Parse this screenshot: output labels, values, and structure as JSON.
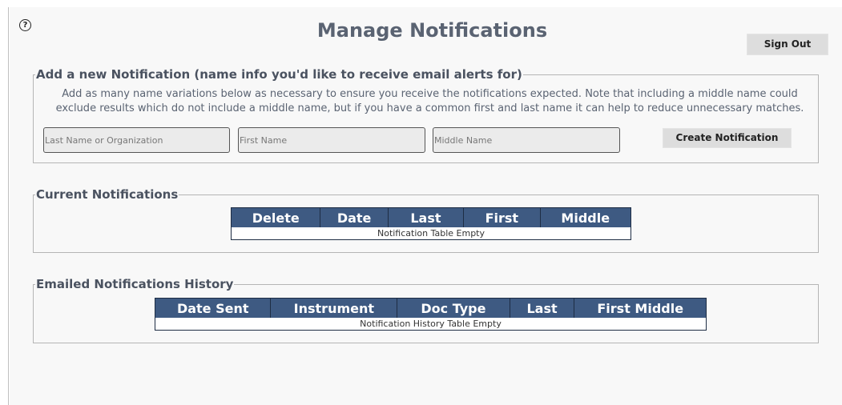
{
  "header": {
    "title": "Manage Notifications",
    "help_icon": "?",
    "sign_out_label": "Sign Out"
  },
  "add_section": {
    "legend": "Add a new Notification (name info you'd like to receive email alerts for)",
    "instructions_line1": "Add as many name variations below as necessary to ensure you receive the notifications expected. Note that including a middle name could",
    "instructions_line2": "exclude results which do not include a middle name, but if you have a common first and last name it can help to reduce unnecessary matches.",
    "last_placeholder": "Last Name or Organization",
    "first_placeholder": "First Name",
    "middle_placeholder": "Middle Name",
    "create_label": "Create Notification"
  },
  "current_section": {
    "legend": "Current Notifications",
    "columns": [
      "Delete",
      "Date",
      "Last",
      "First",
      "Middle"
    ],
    "empty_text": "Notification Table Empty"
  },
  "history_section": {
    "legend": "Emailed Notifications History",
    "columns": [
      "Date Sent",
      "Instrument",
      "Doc Type",
      "Last",
      "First Middle"
    ],
    "empty_text": "Notification History Table Empty"
  },
  "colors": {
    "table_header": "#3e5a82",
    "title_text": "#5a6372",
    "button_bg": "#dddddd"
  },
  "icons": [
    "help-icon"
  ]
}
